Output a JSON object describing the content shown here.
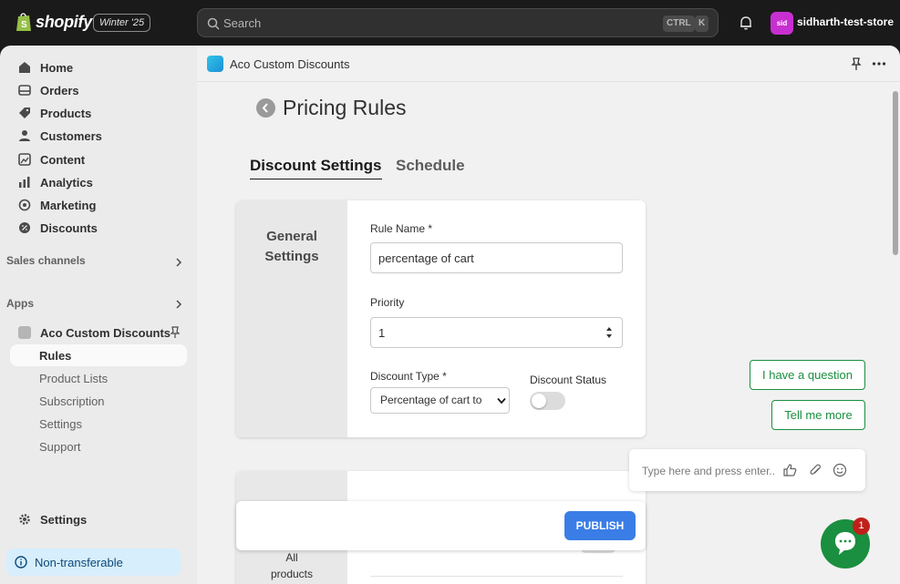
{
  "topbar": {
    "brand": "shopify",
    "badge": "Winter '25",
    "search_placeholder": "Search",
    "shortcut_ctrl": "CTRL",
    "shortcut_k": "K",
    "store_initials": "sid",
    "store_name": "sidharth-test-store"
  },
  "sidebar": {
    "items": [
      {
        "label": "Home",
        "icon": "home-icon"
      },
      {
        "label": "Orders",
        "icon": "orders-icon"
      },
      {
        "label": "Products",
        "icon": "tag-icon"
      },
      {
        "label": "Customers",
        "icon": "person-icon"
      },
      {
        "label": "Content",
        "icon": "content-icon"
      },
      {
        "label": "Analytics",
        "icon": "bar-chart-icon"
      },
      {
        "label": "Marketing",
        "icon": "target-icon"
      },
      {
        "label": "Discounts",
        "icon": "discount-icon"
      }
    ],
    "sales_channels": "Sales channels",
    "apps": "Apps",
    "app_name": "Aco Custom Discounts",
    "app_subitems": [
      "Rules",
      "Product Lists",
      "Subscription",
      "Settings",
      "Support"
    ],
    "settings": "Settings",
    "non_transferable": "Non-transferable"
  },
  "appbar": {
    "title": "Aco Custom Discounts"
  },
  "page": {
    "title": "Pricing Rules",
    "tabs": [
      "Discount Settings",
      "Schedule"
    ],
    "general_settings_heading_1": "General",
    "general_settings_heading_2": "Settings",
    "rule_name_label": "Rule Name *",
    "rule_name_value": "percentage of cart",
    "priority_label": "Priority",
    "priority_value": "1",
    "discount_type_label": "Discount Type *",
    "discount_type_value": "Percentage of cart to",
    "discount_status_label": "Discount Status",
    "discount_status_on": false,
    "card2_heading_1": "All",
    "card2_heading_2": "products",
    "publish": "PUBLISH"
  },
  "chat": {
    "question": "I have a question",
    "more": "Tell me more",
    "placeholder": "Type here and press enter..",
    "badge": "1",
    "accent": "#1a8f3f"
  }
}
